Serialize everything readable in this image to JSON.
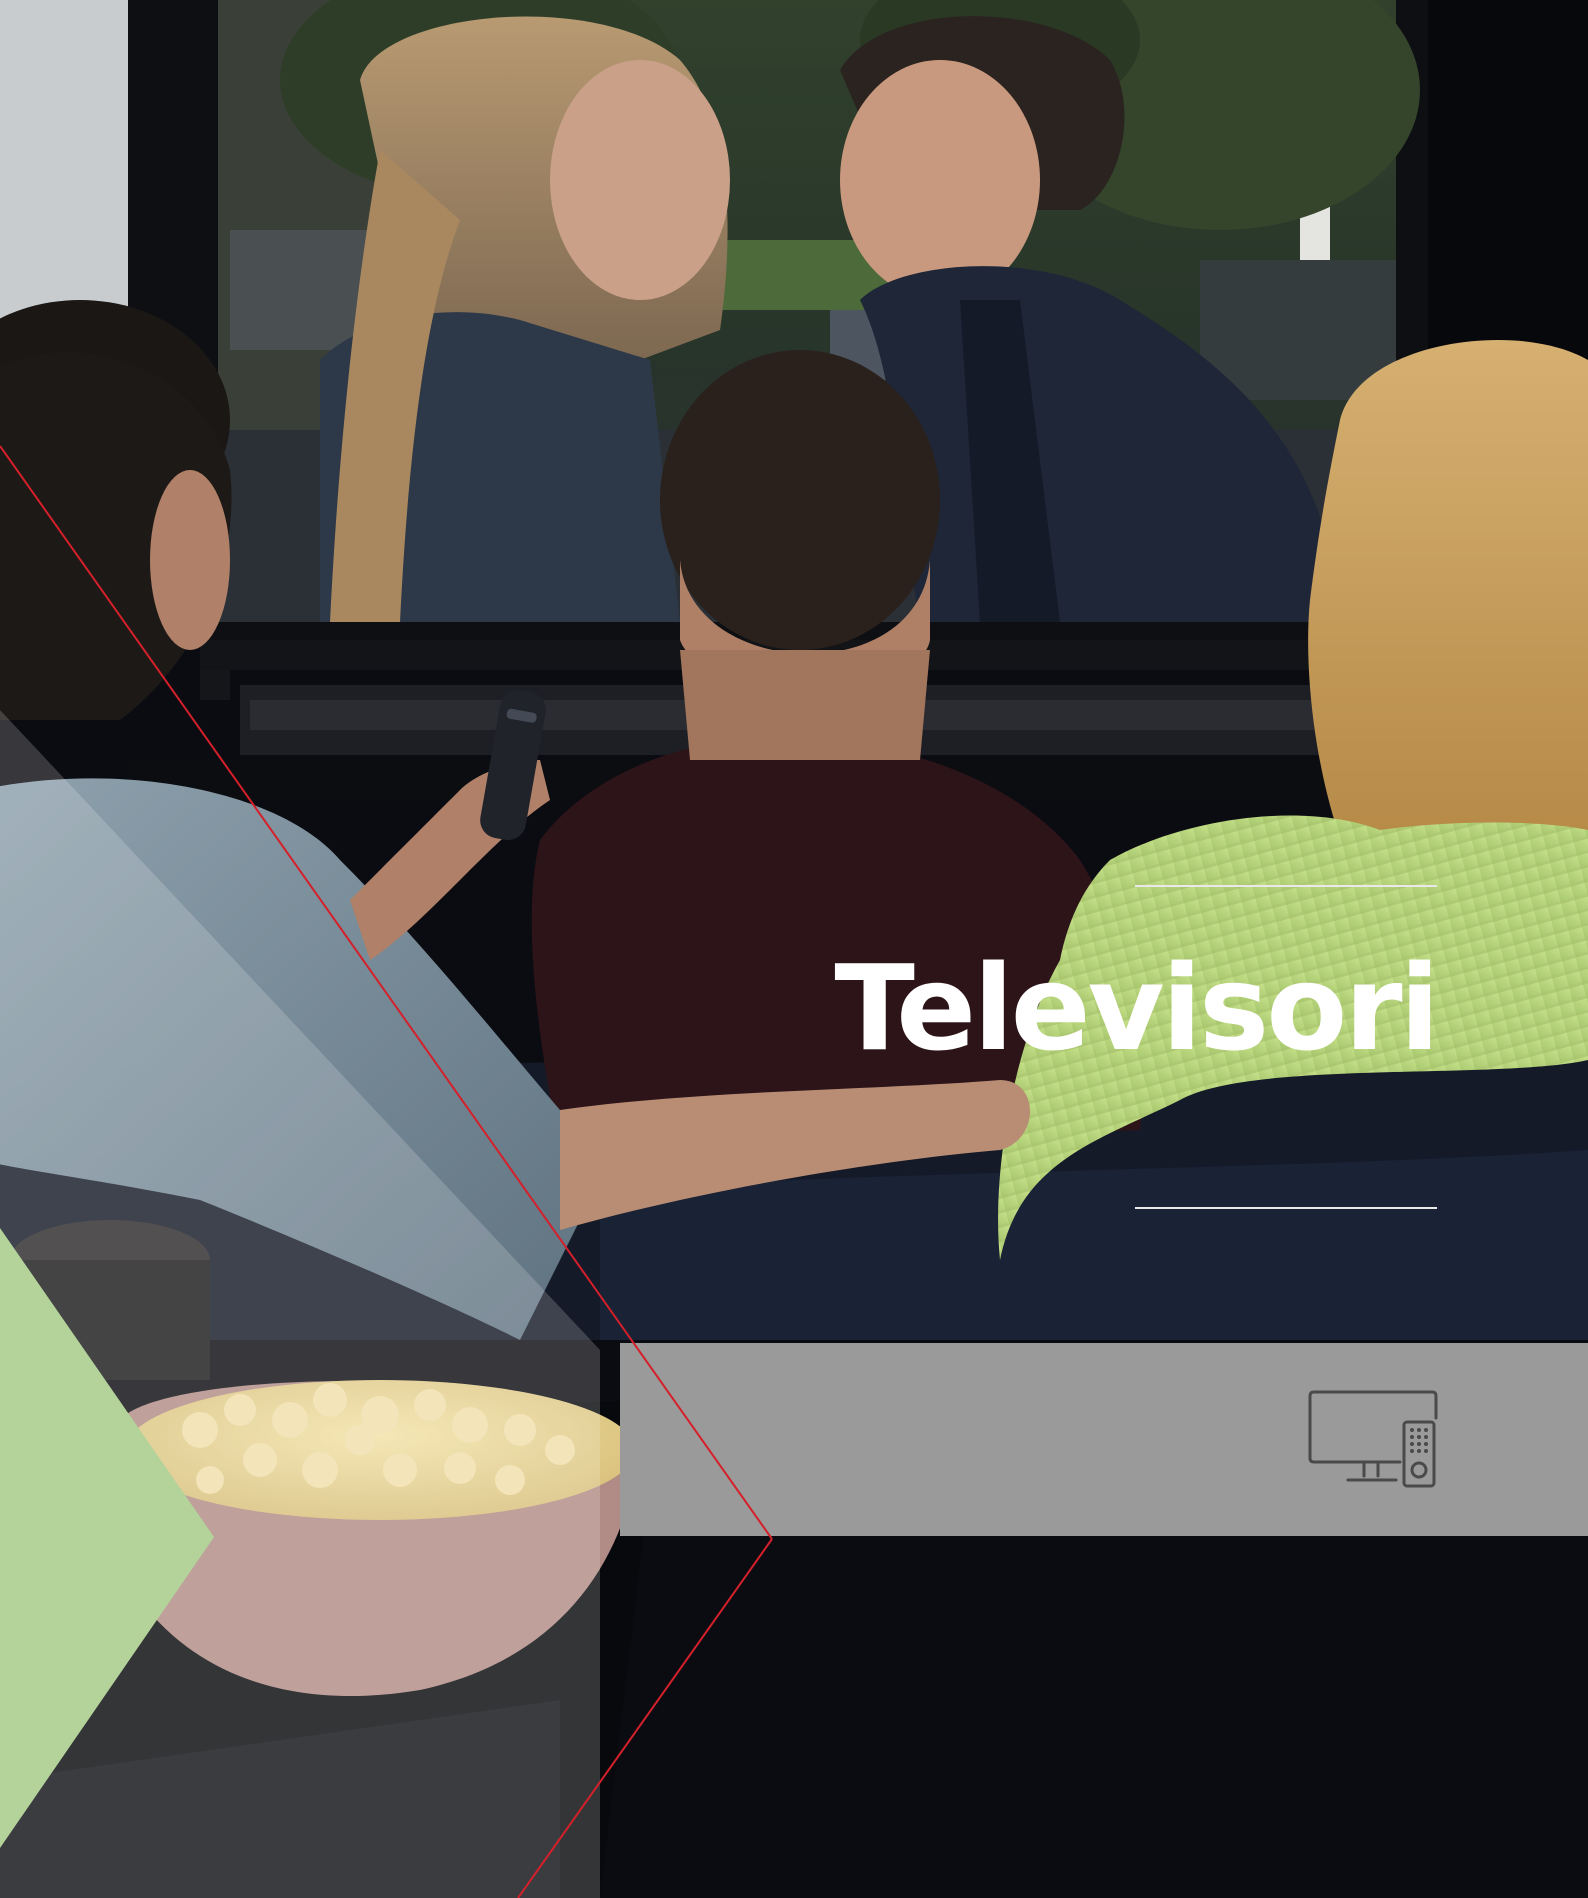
{
  "banner": {
    "title": "Televisori",
    "icon": "tv-remote-icon"
  },
  "colors": {
    "accent_red": "#d4202a",
    "accent_green": "#b3d39a",
    "gray_band": "#9a9a9a",
    "background": "#0a0b10",
    "title_text": "#ffffff"
  }
}
